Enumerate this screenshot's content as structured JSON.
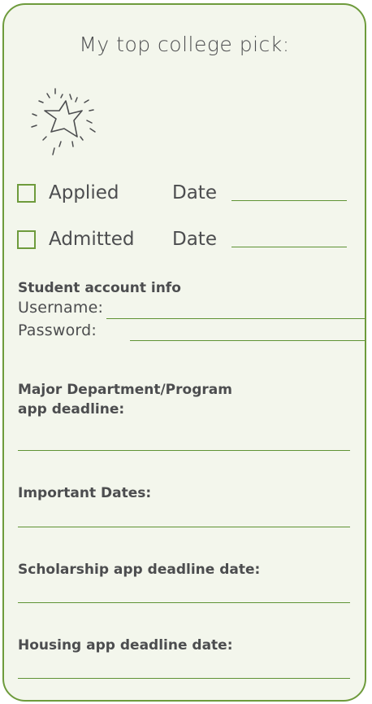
{
  "card": {
    "title": "My top college pick:",
    "accent_color": "#6e9b3c",
    "background_color": "#f3f6ec",
    "star_icon": "sparkle-star-icon"
  },
  "status": {
    "applied_label": "Applied",
    "admitted_label": "Admitted",
    "date_label": "Date"
  },
  "account": {
    "heading": "Student account info",
    "username_label": "Username:",
    "password_label": "Password:"
  },
  "sections": {
    "major_deadline_line1": "Major Department/Program",
    "major_deadline_line2": "app deadline:",
    "important_dates": "Important Dates:",
    "scholarship_deadline": "Scholarship app deadline date:",
    "housing_deadline": "Housing app deadline date:"
  }
}
